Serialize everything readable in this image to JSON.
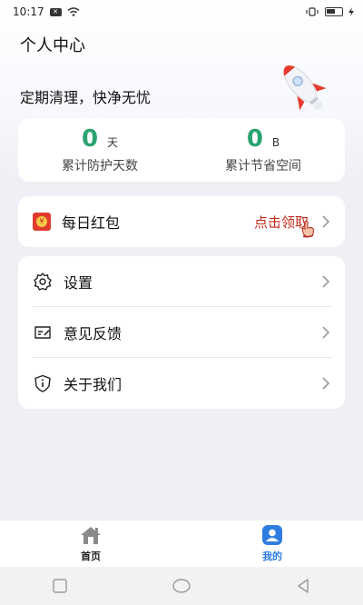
{
  "status_bar": {
    "time": "10:17",
    "badge": "✕"
  },
  "header": {
    "title": "个人中心",
    "slogan": "定期清理，快净无忧"
  },
  "stats": [
    {
      "value": "0",
      "unit": "天",
      "label": "累计防护天数"
    },
    {
      "value": "0",
      "unit": "B",
      "label": "累计节省空间"
    }
  ],
  "red_packet": {
    "label": "每日红包",
    "action": "点击领取",
    "icon_glyph": "¥"
  },
  "menu": {
    "items": [
      {
        "label": "设置",
        "icon": "gear-icon"
      },
      {
        "label": "意见反馈",
        "icon": "feedback-icon"
      },
      {
        "label": "关于我们",
        "icon": "info-icon"
      }
    ]
  },
  "tabs": [
    {
      "label": "首页",
      "icon": "home-icon",
      "active": false
    },
    {
      "label": "我的",
      "icon": "profile-icon",
      "active": true
    }
  ],
  "colors": {
    "accent_green": "#2aa370",
    "red": "#c0281c",
    "tab_active": "#2f7de1",
    "tab_inactive": "#8a8a8a"
  }
}
